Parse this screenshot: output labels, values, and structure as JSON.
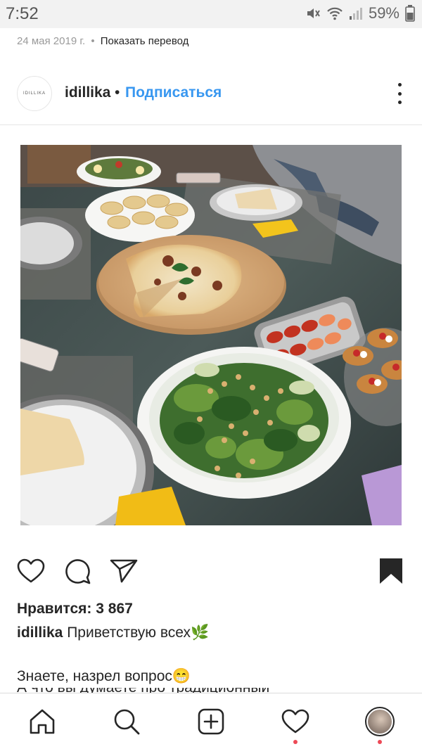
{
  "status_bar": {
    "time": "7:52",
    "battery": "59%",
    "icons": [
      "mute-icon",
      "wifi-icon",
      "signal-icon",
      "battery-icon"
    ]
  },
  "previous_post": {
    "date": "24 мая 2019 г.",
    "separator": "•",
    "translate_link": "Показать перевод"
  },
  "post": {
    "avatar_text": "IDILLIKA",
    "username": "idillika",
    "separator": "•",
    "follow_label": "Подписаться",
    "likes": "Нравится: 3 867",
    "caption_user": "idillika",
    "caption_text": "Приветствую всех🌿",
    "caption_line2": "Знаете, назрел вопрос😁",
    "caption_line3_partial": "А что вы думаете про традиционный новый?"
  },
  "colors": {
    "accent": "#3897f0",
    "text": "#262626",
    "muted": "#9a9a9a",
    "notification": "#ed4956"
  },
  "actions": {
    "like_icon": "heart-icon",
    "comment_icon": "comment-icon",
    "share_icon": "send-icon",
    "save_icon": "bookmark-icon"
  },
  "bottom_nav": {
    "items": [
      "home-icon",
      "search-icon",
      "add-icon",
      "activity-icon",
      "profile-icon"
    ]
  }
}
